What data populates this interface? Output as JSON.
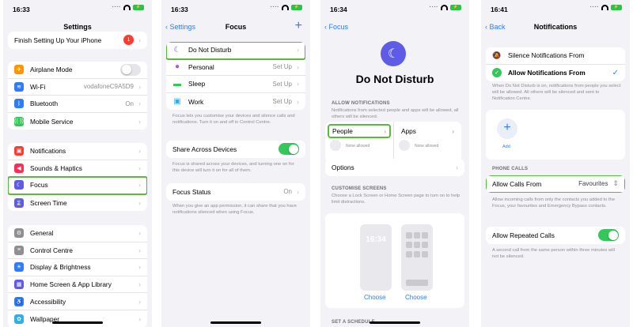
{
  "panel1": {
    "time": "16:33",
    "title": "Settings",
    "finish_setup": "Finish Setting Up Your iPhone",
    "finish_badge": "1",
    "group1": [
      {
        "label": "Airplane Mode",
        "icon": "airplane-icon",
        "color": "#ff9500"
      },
      {
        "label": "Wi-Fi",
        "value": "vodafoneC9A5D9",
        "icon": "wifi-icon",
        "color": "#2f7cf6"
      },
      {
        "label": "Bluetooth",
        "value": "On",
        "icon": "bluetooth-icon",
        "color": "#2f7cf6"
      },
      {
        "label": "Mobile Service",
        "icon": "antenna-icon",
        "color": "#34c759"
      }
    ],
    "group2": [
      {
        "label": "Notifications",
        "icon": "bell-icon",
        "color": "#ff3b30"
      },
      {
        "label": "Sounds & Haptics",
        "icon": "speaker-icon",
        "color": "#ff2d55"
      },
      {
        "label": "Focus",
        "icon": "moon-icon",
        "color": "#5e5ce6"
      },
      {
        "label": "Screen Time",
        "icon": "hourglass-icon",
        "color": "#5e5ce6"
      }
    ],
    "group3": [
      {
        "label": "General",
        "icon": "gear-icon",
        "color": "#8e8e93"
      },
      {
        "label": "Control Centre",
        "icon": "switches-icon",
        "color": "#8e8e93"
      },
      {
        "label": "Display & Brightness",
        "icon": "sun-icon",
        "color": "#2f7cf6"
      },
      {
        "label": "Home Screen & App Library",
        "icon": "grid-icon",
        "color": "#5e5ce6"
      },
      {
        "label": "Accessibility",
        "icon": "person-icon",
        "color": "#2f7cf6"
      },
      {
        "label": "Wallpaper",
        "icon": "flower-icon",
        "color": "#32ade6"
      }
    ]
  },
  "panel2": {
    "time": "16:33",
    "back": "Settings",
    "title": "Focus",
    "items": [
      {
        "label": "Do Not Disturb",
        "value": "",
        "icon": "moon-icon"
      },
      {
        "label": "Personal",
        "value": "Set Up",
        "icon": "person-icon"
      },
      {
        "label": "Sleep",
        "value": "Set Up",
        "icon": "bed-icon"
      },
      {
        "label": "Work",
        "value": "Set Up",
        "icon": "badge-icon"
      }
    ],
    "focus_footer": "Focus lets you customise your devices and silence calls and notifications. Turn it on and off in Control Centre.",
    "share_label": "Share Across Devices",
    "share_footer": "Focus is shared across your devices, and turning one on for this device will turn it on for all of them.",
    "status_label": "Focus Status",
    "status_value": "On",
    "status_footer": "When you give an app permission, it can share that you have notifications silenced when using Focus."
  },
  "panel3": {
    "time": "16:34",
    "back": "Focus",
    "title": "Do Not Disturb",
    "allow_header": "ALLOW NOTIFICATIONS",
    "allow_desc": "Notifications from selected people and apps will be allowed, all others will be silenced.",
    "people": "People",
    "apps": "Apps",
    "none_allowed": "None allowed",
    "options": "Options",
    "customise_header": "CUSTOMISE SCREENS",
    "customise_desc": "Choose a Lock Screen or Home Screen page to turn on to help limit distractions.",
    "lock_time": "16:34",
    "choose": "Choose",
    "schedule_header": "SET A SCHEDULE"
  },
  "panel4": {
    "time": "16:41",
    "back": "Back",
    "title": "Notifications",
    "silence_from": "Silence Notifications From",
    "allow_from": "Allow Notifications From",
    "allow_desc": "When Do Not Disturb is on, notifications from people you select will be allowed. All others will be silenced and sent to Notification Centre.",
    "add": "Add",
    "phone_calls_header": "PHONE CALLS",
    "allow_calls": "Allow Calls From",
    "allow_calls_value": "Favourites",
    "calls_desc": "Allow incoming calls from only the contacts you added to the Focus, your favourites and Emergency Bypass contacts.",
    "repeated": "Allow Repeated Calls",
    "repeated_desc": "A second call from the same person within three minutes will not be silenced."
  }
}
